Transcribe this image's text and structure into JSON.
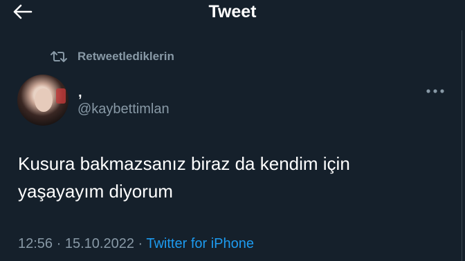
{
  "header": {
    "title": "Tweet",
    "back_icon": "arrow-left-icon"
  },
  "retweet": {
    "icon": "retweet-icon",
    "label": "Retweetlediklerin"
  },
  "author": {
    "display_name": ",",
    "handle": "@kaybettimlan"
  },
  "tweet": {
    "line1": "Kusura bakmazsanız biraz da kendim için",
    "line2": "yaşayayım diyorum"
  },
  "meta": {
    "time": "12:56",
    "separator1": " · ",
    "date": "15.10.2022",
    "separator2": " · ",
    "source": "Twitter for iPhone"
  },
  "colors": {
    "background": "#15202b",
    "text_primary": "#ffffff",
    "text_secondary": "#8899a6",
    "link": "#1d9bf0"
  },
  "more_icon": "more-horizontal-icon"
}
